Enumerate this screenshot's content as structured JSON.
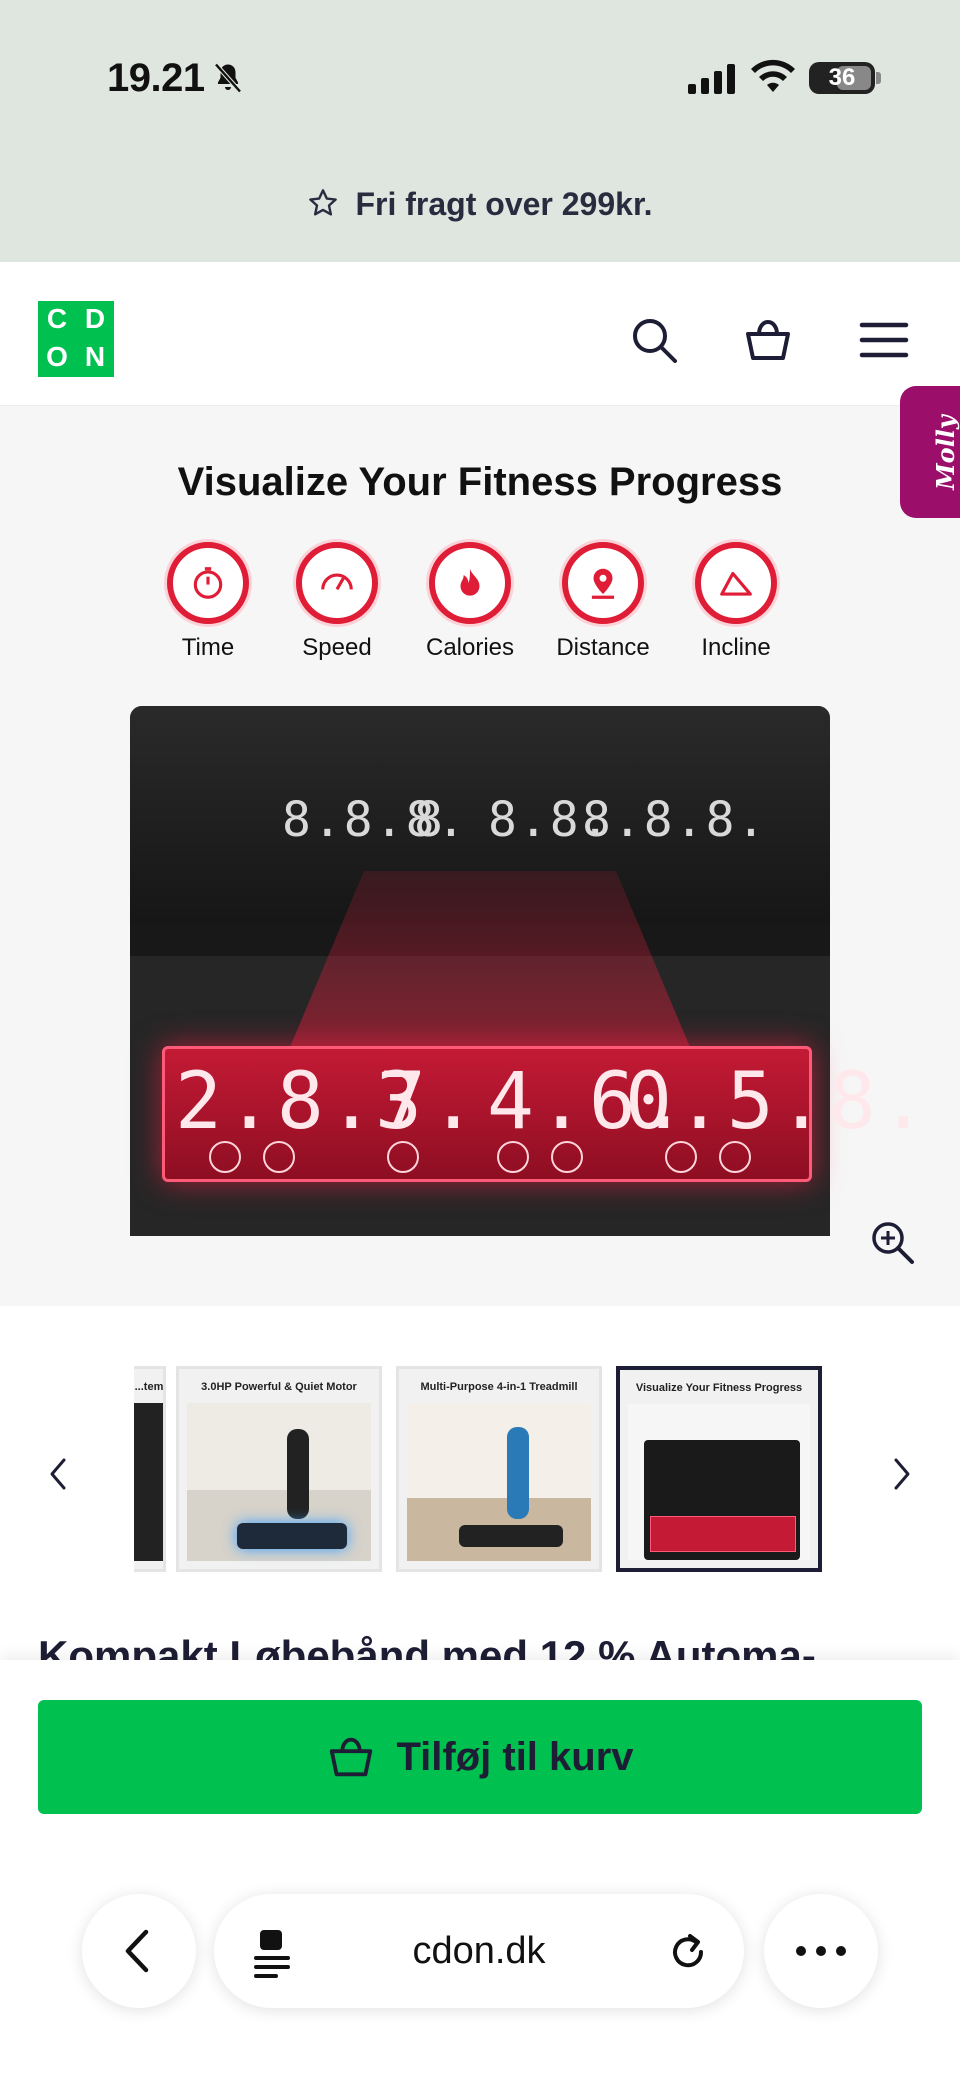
{
  "status_bar": {
    "time": "19.21",
    "battery": "36"
  },
  "promo": {
    "text": "Fri fragt over 299kr."
  },
  "header": {
    "logo_letters": [
      "C",
      "D",
      "O",
      "N"
    ],
    "chat_tab": "Molly"
  },
  "hero": {
    "title": "Visualize Your Fitness Progress",
    "metrics": [
      "Time",
      "Speed",
      "Calories",
      "Distance",
      "Incline"
    ],
    "top_display": [
      "8.8.8.",
      "8",
      "8.8.",
      "8.8.8."
    ],
    "main_display": [
      "2.8.7.",
      "3",
      "4.6.",
      "0.5.8."
    ]
  },
  "thumbnails": [
    {
      "caption": "...tem"
    },
    {
      "caption": "3.0HP Powerful & Quiet Motor"
    },
    {
      "caption": "Multi-Purpose 4-in-1 Treadmill"
    },
    {
      "caption": "Visualize Your Fitness Progress",
      "active": true
    }
  ],
  "product": {
    "title_partial": "Kompakt Løbebånd med 12 % Automa-"
  },
  "cart": {
    "add_label": "Tilføj til kurv"
  },
  "browser": {
    "url": "cdon.dk"
  },
  "colors": {
    "brand_green": "#00c050",
    "accent_red": "#e01d36",
    "promo_bg": "#dfe5df",
    "chat_purple": "#9b0f6b"
  },
  "icons": [
    "bell-slash-icon",
    "signal-icon",
    "wifi-icon",
    "star-icon",
    "search-icon",
    "basket-icon",
    "menu-icon",
    "zoom-in-icon",
    "chevron-left-icon",
    "chevron-right-icon",
    "reader-icon",
    "reload-icon",
    "more-icon"
  ]
}
